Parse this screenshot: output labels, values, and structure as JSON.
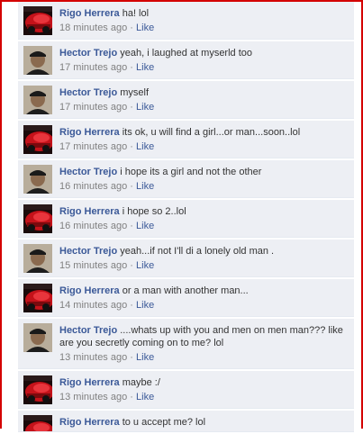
{
  "comments": [
    {
      "author": "Rigo Herrera",
      "text": "ha! lol",
      "time": "18 minutes ago",
      "like": "Like",
      "avatar": "car"
    },
    {
      "author": "Hector Trejo",
      "text": "yeah, i laughed at myserld too",
      "time": "17 minutes ago",
      "like": "Like",
      "avatar": "person"
    },
    {
      "author": "Hector Trejo",
      "text": "myself",
      "time": "17 minutes ago",
      "like": "Like",
      "avatar": "person"
    },
    {
      "author": "Rigo Herrera",
      "text": "its ok, u will find a girl...or man...soon..lol",
      "time": "17 minutes ago",
      "like": "Like",
      "avatar": "car"
    },
    {
      "author": "Hector Trejo",
      "text": "i hope its a girl and not the other",
      "time": "16 minutes ago",
      "like": "Like",
      "avatar": "person"
    },
    {
      "author": "Rigo Herrera",
      "text": "i hope so 2..lol",
      "time": "16 minutes ago",
      "like": "Like",
      "avatar": "car"
    },
    {
      "author": "Hector Trejo",
      "text": "yeah...if not I'll di a lonely old man .",
      "time": "15 minutes ago",
      "like": "Like",
      "avatar": "person"
    },
    {
      "author": "Rigo Herrera",
      "text": "or a man with another man...",
      "time": "14 minutes ago",
      "like": "Like",
      "avatar": "car"
    },
    {
      "author": "Hector Trejo",
      "text": "....whats up with you and men on men man??? like are you secretly coming on to me? lol",
      "time": "13 minutes ago",
      "like": "Like",
      "avatar": "person"
    },
    {
      "author": "Rigo Herrera",
      "text": "maybe :/",
      "time": "13 minutes ago",
      "like": "Like",
      "avatar": "car"
    },
    {
      "author": "Rigo Herrera",
      "text": "to u accept me? lol",
      "time": "",
      "like": "",
      "avatar": "car"
    }
  ],
  "separator": "·",
  "colors": {
    "author": "#3b5998",
    "comment_bg": "#edeff4",
    "frame": "#d40000"
  }
}
